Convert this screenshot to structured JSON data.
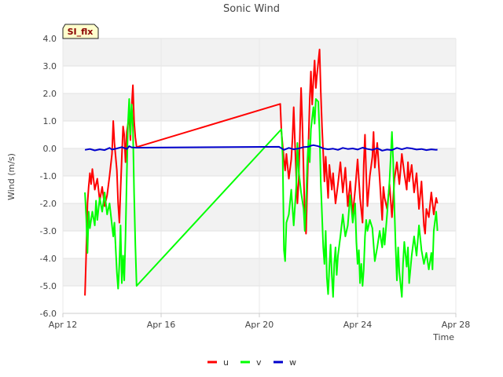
{
  "chart_data": {
    "type": "line",
    "title": "Sonic Wind",
    "tag": "SI_flx",
    "xlabel": "Time",
    "ylabel": "Wind (m/s)",
    "ylim": [
      -6.0,
      4.0
    ],
    "yticks": [
      "-6.0",
      "-5.0",
      "-4.0",
      "-3.0",
      "-2.0",
      "-1.0",
      "0.0",
      "1.0",
      "2.0",
      "3.0",
      "4.0"
    ],
    "xlim": [
      12,
      28
    ],
    "xticks": [
      {
        "label": "Apr 12",
        "value": 12
      },
      {
        "label": "Apr 16",
        "value": 16
      },
      {
        "label": "Apr 20",
        "value": 20
      },
      {
        "label": "Apr 24",
        "value": 24
      },
      {
        "label": "Apr 28",
        "value": 28
      }
    ],
    "grid": true,
    "legend_position": "bottom-center",
    "series": [
      {
        "name": "u",
        "color": "#ff0000",
        "points": [
          [
            12.9,
            -5.35
          ],
          [
            12.95,
            -3.8
          ],
          [
            13.0,
            -2.0
          ],
          [
            13.05,
            -1.4
          ],
          [
            13.1,
            -0.9
          ],
          [
            13.15,
            -1.3
          ],
          [
            13.2,
            -0.75
          ],
          [
            13.3,
            -1.5
          ],
          [
            13.4,
            -1.1
          ],
          [
            13.5,
            -1.9
          ],
          [
            13.6,
            -1.4
          ],
          [
            13.7,
            -2.1
          ],
          [
            13.8,
            -1.7
          ],
          [
            13.9,
            -1.0
          ],
          [
            14.0,
            -0.2
          ],
          [
            14.05,
            1.0
          ],
          [
            14.1,
            0.2
          ],
          [
            14.2,
            -0.8
          ],
          [
            14.25,
            -2.0
          ],
          [
            14.3,
            -2.7
          ],
          [
            14.35,
            -1.5
          ],
          [
            14.4,
            -0.3
          ],
          [
            14.45,
            0.8
          ],
          [
            14.5,
            0.5
          ],
          [
            14.55,
            -0.5
          ],
          [
            14.6,
            0.6
          ],
          [
            14.7,
            1.2
          ],
          [
            14.75,
            0.3
          ],
          [
            14.8,
            1.5
          ],
          [
            14.85,
            2.3
          ],
          [
            14.9,
            1.0
          ],
          [
            14.95,
            0.4
          ],
          [
            15.0,
            0.05
          ],
          [
            20.85,
            1.62
          ],
          [
            20.9,
            0.6
          ],
          [
            21.0,
            -0.4
          ],
          [
            21.05,
            -0.8
          ],
          [
            21.1,
            -0.2
          ],
          [
            21.2,
            -1.1
          ],
          [
            21.3,
            -0.4
          ],
          [
            21.35,
            0.4
          ],
          [
            21.4,
            1.5
          ],
          [
            21.45,
            0.2
          ],
          [
            21.5,
            -1.0
          ],
          [
            21.55,
            -2.0
          ],
          [
            21.6,
            -1.2
          ],
          [
            21.65,
            0.5
          ],
          [
            21.7,
            2.2
          ],
          [
            21.75,
            0.9
          ],
          [
            21.8,
            -0.8
          ],
          [
            21.85,
            -2.5
          ],
          [
            21.9,
            -3.1
          ],
          [
            21.95,
            -1.5
          ],
          [
            22.0,
            0.2
          ],
          [
            22.05,
            1.8
          ],
          [
            22.1,
            2.8
          ],
          [
            22.15,
            1.6
          ],
          [
            22.2,
            2.5
          ],
          [
            22.25,
            3.2
          ],
          [
            22.3,
            2.2
          ],
          [
            22.35,
            2.7
          ],
          [
            22.45,
            3.6
          ],
          [
            22.5,
            2.1
          ],
          [
            22.55,
            0.8
          ],
          [
            22.6,
            -0.2
          ],
          [
            22.65,
            -1.2
          ],
          [
            22.7,
            -0.3
          ],
          [
            22.8,
            -1.8
          ],
          [
            22.85,
            -0.6
          ],
          [
            22.95,
            -1.5
          ],
          [
            23.0,
            -0.9
          ],
          [
            23.1,
            -2.0
          ],
          [
            23.2,
            -1.3
          ],
          [
            23.3,
            -0.5
          ],
          [
            23.4,
            -1.6
          ],
          [
            23.5,
            -0.7
          ],
          [
            23.6,
            -2.1
          ],
          [
            23.7,
            -1.2
          ],
          [
            23.8,
            -2.4
          ],
          [
            23.9,
            -1.5
          ],
          [
            24.0,
            -0.4
          ],
          [
            24.1,
            -1.8
          ],
          [
            24.2,
            -2.7
          ],
          [
            24.25,
            -0.6
          ],
          [
            24.3,
            0.5
          ],
          [
            24.35,
            -0.9
          ],
          [
            24.4,
            -2.1
          ],
          [
            24.5,
            -1.0
          ],
          [
            24.6,
            -0.3
          ],
          [
            24.65,
            0.6
          ],
          [
            24.7,
            -0.7
          ],
          [
            24.8,
            0.2
          ],
          [
            24.9,
            -1.1
          ],
          [
            25.0,
            -2.6
          ],
          [
            25.05,
            -1.4
          ],
          [
            25.1,
            -1.8
          ],
          [
            25.2,
            -2.2
          ],
          [
            25.3,
            -1.3
          ],
          [
            25.4,
            -2.5
          ],
          [
            25.5,
            -1.1
          ],
          [
            25.6,
            -0.5
          ],
          [
            25.7,
            -1.3
          ],
          [
            25.8,
            -0.2
          ],
          [
            25.9,
            -0.9
          ],
          [
            26.0,
            -1.5
          ],
          [
            26.05,
            -0.5
          ],
          [
            26.1,
            -1.2
          ],
          [
            26.2,
            -0.6
          ],
          [
            26.3,
            -1.6
          ],
          [
            26.4,
            -0.9
          ],
          [
            26.5,
            -2.2
          ],
          [
            26.6,
            -1.2
          ],
          [
            26.7,
            -2.8
          ],
          [
            26.75,
            -3.1
          ],
          [
            26.8,
            -2.2
          ],
          [
            26.9,
            -2.5
          ],
          [
            27.0,
            -1.6
          ],
          [
            27.1,
            -2.4
          ],
          [
            27.2,
            -1.8
          ],
          [
            27.25,
            -2.0
          ]
        ]
      },
      {
        "name": "v",
        "color": "#00ff00",
        "points": [
          [
            12.9,
            -1.6
          ],
          [
            12.95,
            -2.5
          ],
          [
            13.0,
            -3.8
          ],
          [
            13.05,
            -2.3
          ],
          [
            13.1,
            -2.9
          ],
          [
            13.2,
            -2.3
          ],
          [
            13.3,
            -2.8
          ],
          [
            13.35,
            -1.9
          ],
          [
            13.4,
            -2.6
          ],
          [
            13.5,
            -1.8
          ],
          [
            13.6,
            -2.3
          ],
          [
            13.7,
            -1.6
          ],
          [
            13.8,
            -2.4
          ],
          [
            13.9,
            -2.0
          ],
          [
            14.0,
            -2.8
          ],
          [
            14.05,
            -3.2
          ],
          [
            14.1,
            -2.7
          ],
          [
            14.2,
            -4.5
          ],
          [
            14.25,
            -5.1
          ],
          [
            14.3,
            -4.2
          ],
          [
            14.35,
            -2.8
          ],
          [
            14.4,
            -4.9
          ],
          [
            14.45,
            -3.9
          ],
          [
            14.5,
            -4.8
          ],
          [
            14.55,
            -3.2
          ],
          [
            14.6,
            -1.0
          ],
          [
            14.65,
            0.9
          ],
          [
            14.7,
            1.8
          ],
          [
            14.75,
            0.5
          ],
          [
            14.8,
            1.6
          ],
          [
            14.85,
            0.8
          ],
          [
            14.9,
            -1.6
          ],
          [
            14.95,
            -3.5
          ],
          [
            15.0,
            -5.0
          ],
          [
            20.9,
            0.7
          ],
          [
            20.95,
            -0.3
          ],
          [
            21.0,
            -3.7
          ],
          [
            21.05,
            -4.1
          ],
          [
            21.1,
            -2.7
          ],
          [
            21.2,
            -2.4
          ],
          [
            21.3,
            -1.5
          ],
          [
            21.4,
            -2.8
          ],
          [
            21.5,
            -1.4
          ],
          [
            21.55,
            0.2
          ],
          [
            21.6,
            -0.8
          ],
          [
            21.7,
            -1.6
          ],
          [
            21.8,
            -2.2
          ],
          [
            21.85,
            -3.0
          ],
          [
            21.9,
            -2.0
          ],
          [
            21.95,
            -0.6
          ],
          [
            22.0,
            0.3
          ],
          [
            22.05,
            -0.5
          ],
          [
            22.1,
            0.7
          ],
          [
            22.2,
            1.5
          ],
          [
            22.25,
            0.9
          ],
          [
            22.3,
            1.8
          ],
          [
            22.4,
            1.7
          ],
          [
            22.45,
            0.6
          ],
          [
            22.5,
            -1.2
          ],
          [
            22.55,
            -2.4
          ],
          [
            22.6,
            -3.6
          ],
          [
            22.65,
            -4.2
          ],
          [
            22.7,
            -3.0
          ],
          [
            22.75,
            -4.7
          ],
          [
            22.8,
            -5.3
          ],
          [
            22.85,
            -4.3
          ],
          [
            22.9,
            -3.5
          ],
          [
            22.95,
            -4.6
          ],
          [
            23.0,
            -5.4
          ],
          [
            23.05,
            -4.2
          ],
          [
            23.1,
            -3.6
          ],
          [
            23.15,
            -4.6
          ],
          [
            23.2,
            -3.9
          ],
          [
            23.3,
            -3.2
          ],
          [
            23.4,
            -2.4
          ],
          [
            23.5,
            -3.2
          ],
          [
            23.6,
            -2.8
          ],
          [
            23.7,
            -1.7
          ],
          [
            23.8,
            -2.7
          ],
          [
            23.9,
            -2.0
          ],
          [
            23.95,
            -3.4
          ],
          [
            24.0,
            -4.2
          ],
          [
            24.05,
            -3.7
          ],
          [
            24.1,
            -4.9
          ],
          [
            24.15,
            -4.2
          ],
          [
            24.2,
            -5.0
          ],
          [
            24.25,
            -4.4
          ],
          [
            24.3,
            -3.2
          ],
          [
            24.35,
            -2.6
          ],
          [
            24.4,
            -3.0
          ],
          [
            24.5,
            -2.6
          ],
          [
            24.6,
            -2.9
          ],
          [
            24.7,
            -4.1
          ],
          [
            24.8,
            -3.6
          ],
          [
            24.9,
            -3.0
          ],
          [
            25.0,
            -3.6
          ],
          [
            25.05,
            -2.9
          ],
          [
            25.1,
            -3.5
          ],
          [
            25.2,
            -2.4
          ],
          [
            25.3,
            -1.2
          ],
          [
            25.4,
            0.6
          ],
          [
            25.45,
            -0.5
          ],
          [
            25.5,
            -2.2
          ],
          [
            25.55,
            -3.6
          ],
          [
            25.6,
            -4.8
          ],
          [
            25.65,
            -3.6
          ],
          [
            25.7,
            -4.5
          ],
          [
            25.8,
            -5.4
          ],
          [
            25.85,
            -4.2
          ],
          [
            25.9,
            -3.4
          ],
          [
            26.0,
            -4.3
          ],
          [
            26.05,
            -3.6
          ],
          [
            26.1,
            -4.9
          ],
          [
            26.2,
            -3.9
          ],
          [
            26.3,
            -3.2
          ],
          [
            26.4,
            -3.9
          ],
          [
            26.5,
            -2.8
          ],
          [
            26.6,
            -3.7
          ],
          [
            26.7,
            -4.2
          ],
          [
            26.8,
            -3.8
          ],
          [
            26.9,
            -4.4
          ],
          [
            27.0,
            -3.8
          ],
          [
            27.05,
            -4.4
          ],
          [
            27.1,
            -3.0
          ],
          [
            27.2,
            -2.3
          ],
          [
            27.25,
            -3.0
          ]
        ]
      },
      {
        "name": "w",
        "color": "#0000cc",
        "points": [
          [
            12.9,
            -0.05
          ],
          [
            13.1,
            -0.02
          ],
          [
            13.3,
            -0.07
          ],
          [
            13.5,
            -0.03
          ],
          [
            13.7,
            -0.06
          ],
          [
            13.9,
            0.02
          ],
          [
            14.0,
            -0.04
          ],
          [
            14.2,
            0.0
          ],
          [
            14.4,
            0.05
          ],
          [
            14.6,
            -0.02
          ],
          [
            14.7,
            0.08
          ],
          [
            14.8,
            0.04
          ],
          [
            15.0,
            0.03
          ],
          [
            20.8,
            0.06
          ],
          [
            21.0,
            -0.05
          ],
          [
            21.2,
            0.02
          ],
          [
            21.4,
            -0.03
          ],
          [
            21.6,
            0.0
          ],
          [
            21.8,
            0.05
          ],
          [
            22.0,
            0.06
          ],
          [
            22.1,
            0.1
          ],
          [
            22.2,
            0.12
          ],
          [
            22.4,
            0.08
          ],
          [
            22.6,
            0.0
          ],
          [
            22.8,
            -0.03
          ],
          [
            23.0,
            -0.01
          ],
          [
            23.2,
            -0.05
          ],
          [
            23.4,
            0.02
          ],
          [
            23.6,
            -0.02
          ],
          [
            23.8,
            0.0
          ],
          [
            24.0,
            -0.04
          ],
          [
            24.2,
            0.03
          ],
          [
            24.4,
            -0.02
          ],
          [
            24.6,
            -0.05
          ],
          [
            24.8,
            0.01
          ],
          [
            25.0,
            -0.08
          ],
          [
            25.2,
            -0.04
          ],
          [
            25.4,
            -0.06
          ],
          [
            25.6,
            0.02
          ],
          [
            25.8,
            -0.03
          ],
          [
            26.0,
            0.02
          ],
          [
            26.2,
            0.0
          ],
          [
            26.4,
            -0.04
          ],
          [
            26.6,
            -0.02
          ],
          [
            26.8,
            -0.06
          ],
          [
            27.0,
            -0.03
          ],
          [
            27.2,
            -0.05
          ],
          [
            27.25,
            -0.04
          ]
        ]
      }
    ]
  }
}
